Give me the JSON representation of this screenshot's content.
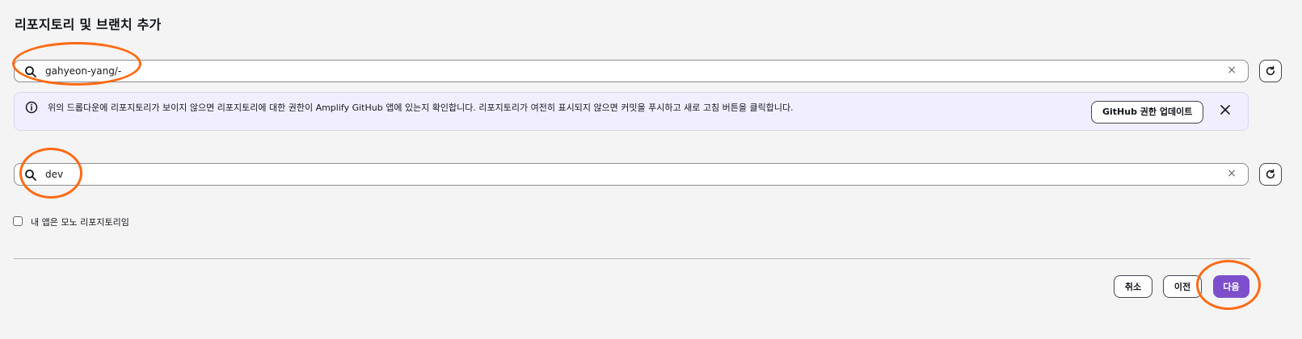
{
  "page": {
    "title": "리포지토리 및 브랜치 추가"
  },
  "repo_search": {
    "value": "gahyeon-yang/-",
    "clear_symbol": "×"
  },
  "info_alert": {
    "message": "위의 드롭다운에 리포지토리가 보이지 않으면 리포지토리에 대한 권한이 Amplify GitHub 앱에 있는지 확인합니다. 리포지토리가 여전히 표시되지 않으면 커밋을 푸시하고 새로 고침 버튼을 클릭합니다.",
    "button_label": "GitHub 권한 업데이트"
  },
  "branch_search": {
    "value": "dev",
    "clear_symbol": "×"
  },
  "monorepo": {
    "label": "내 앱은 모노 리포지토리임",
    "checked": false
  },
  "actions": {
    "cancel_label": "취소",
    "previous_label": "이전",
    "next_label": "다음"
  },
  "colors": {
    "primary": "#7d4fcc",
    "annotation": "#ff6a13",
    "info_bg": "#f1efff"
  },
  "icons": {
    "search": "search-icon",
    "clear": "clear-icon",
    "refresh": "refresh-icon",
    "info": "info-icon",
    "close": "close-icon"
  }
}
